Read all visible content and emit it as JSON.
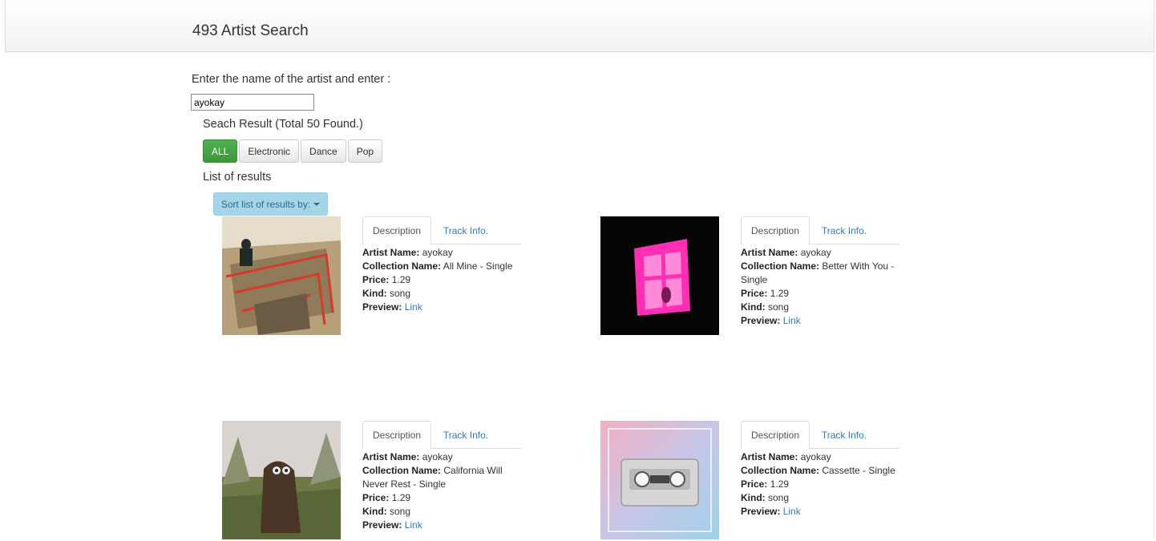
{
  "header": {
    "title": "493 Artist Search"
  },
  "search": {
    "prompt": "Enter the name of the artist and enter :",
    "value": "ayokay"
  },
  "result_count": "Seach Result (Total 50 Found.)",
  "filters": [
    "ALL",
    "Electronic",
    "Dance",
    "Pop"
  ],
  "active_filter": "ALL",
  "list_title": "List of results",
  "sort_label": "Sort list of results by:",
  "labels": {
    "artist": "Artist Name:",
    "collection": "Collection Name:",
    "price": "Price:",
    "kind": "Kind:",
    "preview": "Preview:",
    "link": "Link",
    "tab_description": "Description",
    "tab_track": "Track Info."
  },
  "results": [
    {
      "artist": "ayokay",
      "collection": "All Mine - Single",
      "price": "1.29",
      "kind": "song"
    },
    {
      "artist": "ayokay",
      "collection": "Better With You - Single",
      "price": "1.29",
      "kind": "song"
    },
    {
      "artist": "ayokay",
      "collection": "California Will Never Rest - Single",
      "price": "1.29",
      "kind": "song"
    },
    {
      "artist": "ayokay",
      "collection": "Cassette - Single",
      "price": "1.29",
      "kind": "song"
    }
  ],
  "colors": {
    "active_filter": "#449d44",
    "sort_button": "#a6d4e8",
    "link": "#337ab7"
  }
}
